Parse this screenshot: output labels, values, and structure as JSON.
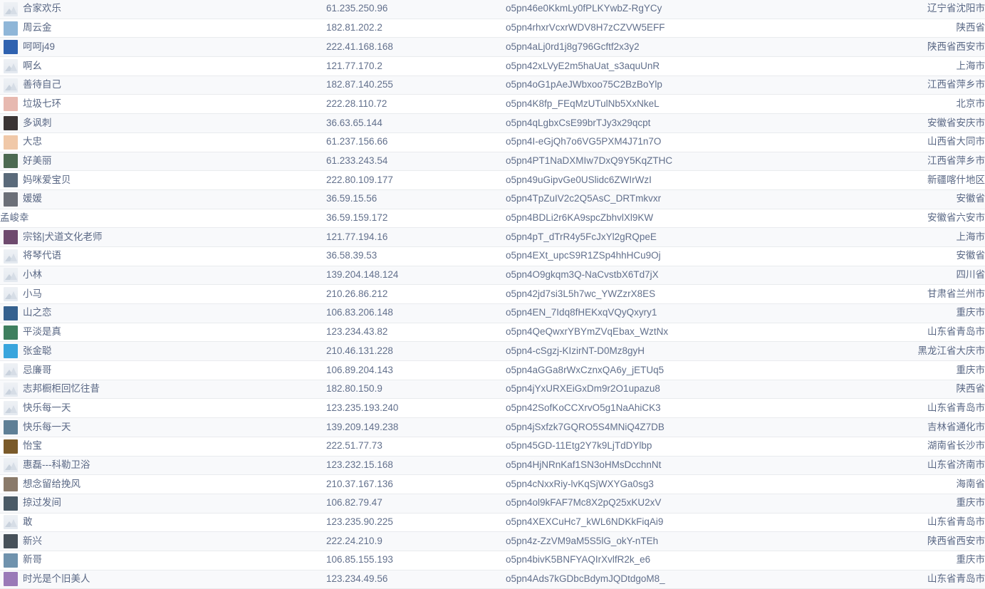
{
  "table": {
    "name": "wechat-follower-table",
    "row_count": 31,
    "columns": [
      {
        "key": "nickname",
        "align": "left"
      },
      {
        "key": "ip",
        "align": "left"
      },
      {
        "key": "openid",
        "align": "left"
      },
      {
        "key": "region",
        "align": "right"
      }
    ],
    "colors": {
      "row_odd_bg": "#f8f9fb",
      "row_even_bg": "#ffffff",
      "row_border": "#e9ebee",
      "text": "#5a6885",
      "avatar_placeholder": "#e4e9f0"
    },
    "rows": [
      {
        "nickname": "合家欢乐",
        "ip": "61.235.250.96",
        "openid": "o5pn46e0KkmLy0fPLKYwbZ-RgYCy",
        "region": "辽宁省沈阳市",
        "avatar": "placeholder-landscape-icon",
        "avatar_color": "#e4e9f0"
      },
      {
        "nickname": "周云金",
        "ip": "182.81.202.2",
        "openid": "o5pn4rhxrVcxrWDV8H7zCZVW5EFF",
        "region": "陕西省",
        "avatar": "photo-avatar",
        "avatar_color": "#8fb6d8"
      },
      {
        "nickname": "呵呵j49",
        "ip": "222.41.168.168",
        "openid": "o5pn4aLj0rd1j8g796Gcftf2x3y2",
        "region": "陕西省西安市",
        "avatar": "photo-avatar",
        "avatar_color": "#2f62b0"
      },
      {
        "nickname": "啊幺",
        "ip": "121.77.170.2",
        "openid": "o5pn42xLVyE2m5haUat_s3aquUnR",
        "region": "上海市",
        "avatar": "placeholder-landscape-icon",
        "avatar_color": "#dfe2e5"
      },
      {
        "nickname": "善待自己",
        "ip": "182.87.140.255",
        "openid": "o5pn4oG1pAeJWbxoo75C2BzBoYlp",
        "region": "江西省萍乡市",
        "avatar": "placeholder-landscape-icon",
        "avatar_color": "#e4e9f0"
      },
      {
        "nickname": "垃圾七环",
        "ip": "222.28.110.72",
        "openid": "o5pn4K8fp_FEqMzUTulNb5XxNkeL",
        "region": "北京市",
        "avatar": "photo-avatar",
        "avatar_color": "#e7b9b0"
      },
      {
        "nickname": "多讽刺",
        "ip": "36.63.65.144",
        "openid": "o5pn4qLgbxCsE99brTJy3x29qcpt",
        "region": "安徽省安庆市",
        "avatar": "photo-avatar",
        "avatar_color": "#3a3434"
      },
      {
        "nickname": "大忠",
        "ip": "61.237.156.66",
        "openid": "o5pn4I-eGjQh7o6VG5PXM4J71n7O",
        "region": "山西省大同市",
        "avatar": "photo-avatar",
        "avatar_color": "#f0c8a8"
      },
      {
        "nickname": "好美丽",
        "ip": "61.233.243.54",
        "openid": "o5pn4PT1NaDXMIw7DxQ9Y5KqZTHC",
        "region": "江西省萍乡市",
        "avatar": "photo-avatar",
        "avatar_color": "#4c6a52"
      },
      {
        "nickname": "妈咪爱宝贝",
        "ip": "222.80.109.177",
        "openid": "o5pn49uGipvGe0USlidc6ZWIrWzI",
        "region": "新疆喀什地区",
        "avatar": "photo-avatar",
        "avatar_color": "#5a6a7a"
      },
      {
        "nickname": "媛媛",
        "ip": "36.59.15.56",
        "openid": "o5pn4TpZuIV2c2Q5AsC_DRTmkvxr",
        "region": "安徽省",
        "avatar": "photo-avatar",
        "avatar_color": "#6b6f78"
      },
      {
        "nickname": "孟峻幸",
        "ip": "36.59.159.172",
        "openid": "o5pn4BDLi2r6KA9spcZbhvlXl9KW",
        "region": "安徽省六安市",
        "avatar": "none",
        "avatar_color": ""
      },
      {
        "nickname": "宗铭|犬道文化老师",
        "ip": "121.77.194.16",
        "openid": "o5pn4pT_dTrR4y5FcJxYl2gRQpeE",
        "region": "上海市",
        "avatar": "photo-avatar",
        "avatar_color": "#6e4a6e"
      },
      {
        "nickname": "将琴代语",
        "ip": "36.58.39.53",
        "openid": "o5pn4EXt_upcS9R1ZSp4hhHCu9Oj",
        "region": "安徽省",
        "avatar": "placeholder-landscape-icon",
        "avatar_color": "#e4e9f0"
      },
      {
        "nickname": "小林",
        "ip": "139.204.148.124",
        "openid": "o5pn4O9gkqm3Q-NaCvstbX6Td7jX",
        "region": "四川省",
        "avatar": "placeholder-landscape-icon",
        "avatar_color": "#e4e9f0"
      },
      {
        "nickname": "小马",
        "ip": "210.26.86.212",
        "openid": "o5pn42jd7si3L5h7wc_YWZzrX8ES",
        "region": "甘肃省兰州市",
        "avatar": "placeholder-landscape-icon",
        "avatar_color": "#e4e9f0"
      },
      {
        "nickname": "山之恋",
        "ip": "106.83.206.148",
        "openid": "o5pn4EN_7Idq8fHEKxqVQyQxyry1",
        "region": "重庆市",
        "avatar": "photo-avatar",
        "avatar_color": "#35618f"
      },
      {
        "nickname": "平淡是真",
        "ip": "123.234.43.82",
        "openid": "o5pn4QeQwxrYBYmZVqEbax_WztNx",
        "region": "山东省青岛市",
        "avatar": "photo-avatar",
        "avatar_color": "#3e7f5e"
      },
      {
        "nickname": "张金聪",
        "ip": "210.46.131.228",
        "openid": "o5pn4-cSgzj-KIzirNT-D0Mz8gyH",
        "region": "黑龙江省大庆市",
        "avatar": "photo-avatar",
        "avatar_color": "#39a5dd"
      },
      {
        "nickname": "忌廉哥",
        "ip": "106.89.204.143",
        "openid": "o5pn4aGGa8rWxCznxQA6y_jETUq5",
        "region": "重庆市",
        "avatar": "placeholder-landscape-icon",
        "avatar_color": "#e4e9f0"
      },
      {
        "nickname": "志邦橱柜回忆往昔",
        "ip": "182.80.150.9",
        "openid": "o5pn4jYxURXEiGxDm9r2O1upazu8",
        "region": "陕西省",
        "avatar": "placeholder-landscape-icon",
        "avatar_color": "#e4e9f0"
      },
      {
        "nickname": "快乐每一天",
        "ip": "123.235.193.240",
        "openid": "o5pn42SofKoCCXrvO5g1NaAhiCK3",
        "region": "山东省青岛市",
        "avatar": "placeholder-landscape-icon",
        "avatar_color": "#e4e9f0"
      },
      {
        "nickname": "快乐每一天",
        "ip": "139.209.149.238",
        "openid": "o5pn4jSxfzk7GQRO5S4MNiQ4Z7DB",
        "region": "吉林省通化市",
        "avatar": "photo-avatar",
        "avatar_color": "#5e7f96"
      },
      {
        "nickname": "怡宝",
        "ip": "222.51.77.73",
        "openid": "o5pn45GD-11Etg2Y7k9LjTdDYlbp",
        "region": "湖南省长沙市",
        "avatar": "photo-avatar",
        "avatar_color": "#7a5a2a"
      },
      {
        "nickname": "惠磊---科勒卫浴",
        "ip": "123.232.15.168",
        "openid": "o5pn4HjNRnKaf1SN3oHMsDcchnNt",
        "region": "山东省济南市",
        "avatar": "placeholder-landscape-icon",
        "avatar_color": "#e4e9f0"
      },
      {
        "nickname": "想念留给挽风",
        "ip": "210.37.167.136",
        "openid": "o5pn4cNxxRiy-lvKqSjWXYGa0sg3",
        "region": "海南省",
        "avatar": "photo-avatar",
        "avatar_color": "#8a7a6a"
      },
      {
        "nickname": "掠过发间",
        "ip": "106.82.79.47",
        "openid": "o5pn4ol9kFAF7Mc8X2pQ25xKU2xV",
        "region": "重庆市",
        "avatar": "photo-avatar",
        "avatar_color": "#4a5a66"
      },
      {
        "nickname": "敢",
        "ip": "123.235.90.225",
        "openid": "o5pn4XEXCuHc7_kWL6NDKkFiqAi9",
        "region": "山东省青岛市",
        "avatar": "placeholder-landscape-icon",
        "avatar_color": "#e4e9f0"
      },
      {
        "nickname": "新兴",
        "ip": "222.24.210.9",
        "openid": "o5pn4z-ZzVM9aM5S5lG_okY-nTEh",
        "region": "陕西省西安市",
        "avatar": "photo-avatar",
        "avatar_color": "#47515a"
      },
      {
        "nickname": "新哥",
        "ip": "106.85.155.193",
        "openid": "o5pn4bivK5BNFYAQIrXvlfR2k_e6",
        "region": "重庆市",
        "avatar": "photo-avatar",
        "avatar_color": "#6f92ad"
      },
      {
        "nickname": "时光是个旧美人",
        "ip": "123.234.49.56",
        "openid": "o5pn4Ads7kGDbcBdymJQDtdgoM8_",
        "region": "山东省青岛市",
        "avatar": "photo-avatar",
        "avatar_color": "#9a7ab8"
      }
    ]
  }
}
